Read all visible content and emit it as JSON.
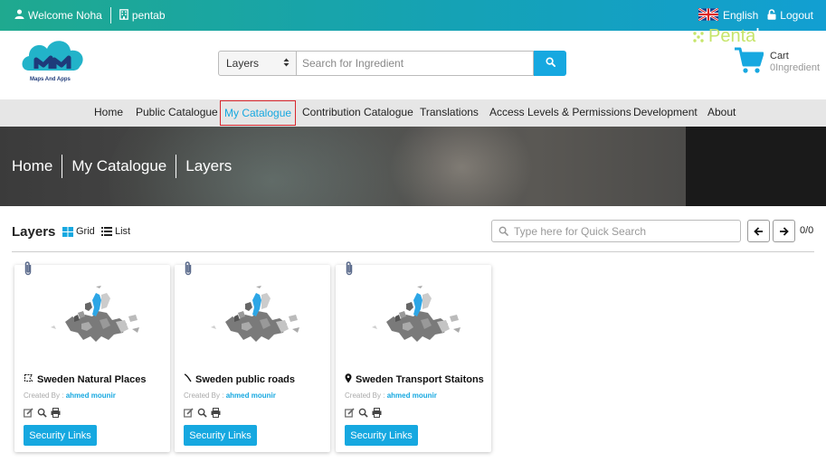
{
  "topbar": {
    "welcome": "Welcome Noha",
    "org": "pentab",
    "language": "English",
    "logout": "Logout"
  },
  "header": {
    "logo_text": "Maps And Apps",
    "select_value": "Layers",
    "search_placeholder": "Search for Ingredient",
    "cart_label": "Cart",
    "cart_count": "0Ingredient"
  },
  "nav": {
    "items": [
      {
        "label": "Home"
      },
      {
        "label": "Public Catalogue"
      },
      {
        "label": "My Catalogue"
      },
      {
        "label": "Contribution Catalogue"
      },
      {
        "label": "Translations"
      },
      {
        "label": "Access Levels & Permissions"
      },
      {
        "label": "Development"
      },
      {
        "label": "About"
      }
    ],
    "active_color": "#16a8e0"
  },
  "banner": {
    "crumbs": [
      "Home",
      "My Catalogue",
      "Layers"
    ],
    "brand": "Penta",
    "brand_suffix": "b"
  },
  "section": {
    "title": "Layers",
    "grid_label": "Grid",
    "list_label": "List",
    "quick_search_placeholder": "Type here for Quick Search",
    "pager": "0/0"
  },
  "cards": [
    {
      "title": "Sweden Natural Places",
      "icon": "polygon-icon",
      "created_by_label": "Created By :",
      "author": "ahmed mounir",
      "button": "Security Links"
    },
    {
      "title": "Sweden public roads",
      "icon": "line-icon",
      "created_by_label": "Created By :",
      "author": "ahmed mounir",
      "button": "Security Links"
    },
    {
      "title": "Sweden Transport Staitons",
      "icon": "map-pin-icon",
      "created_by_label": "Created By :",
      "author": "ahmed mounir",
      "button": "Security Links"
    }
  ],
  "colors": {
    "accent": "#16a8e0",
    "topbar_start": "#1fa98f",
    "topbar_end": "#129fd2",
    "active_border": "#d9262c"
  }
}
